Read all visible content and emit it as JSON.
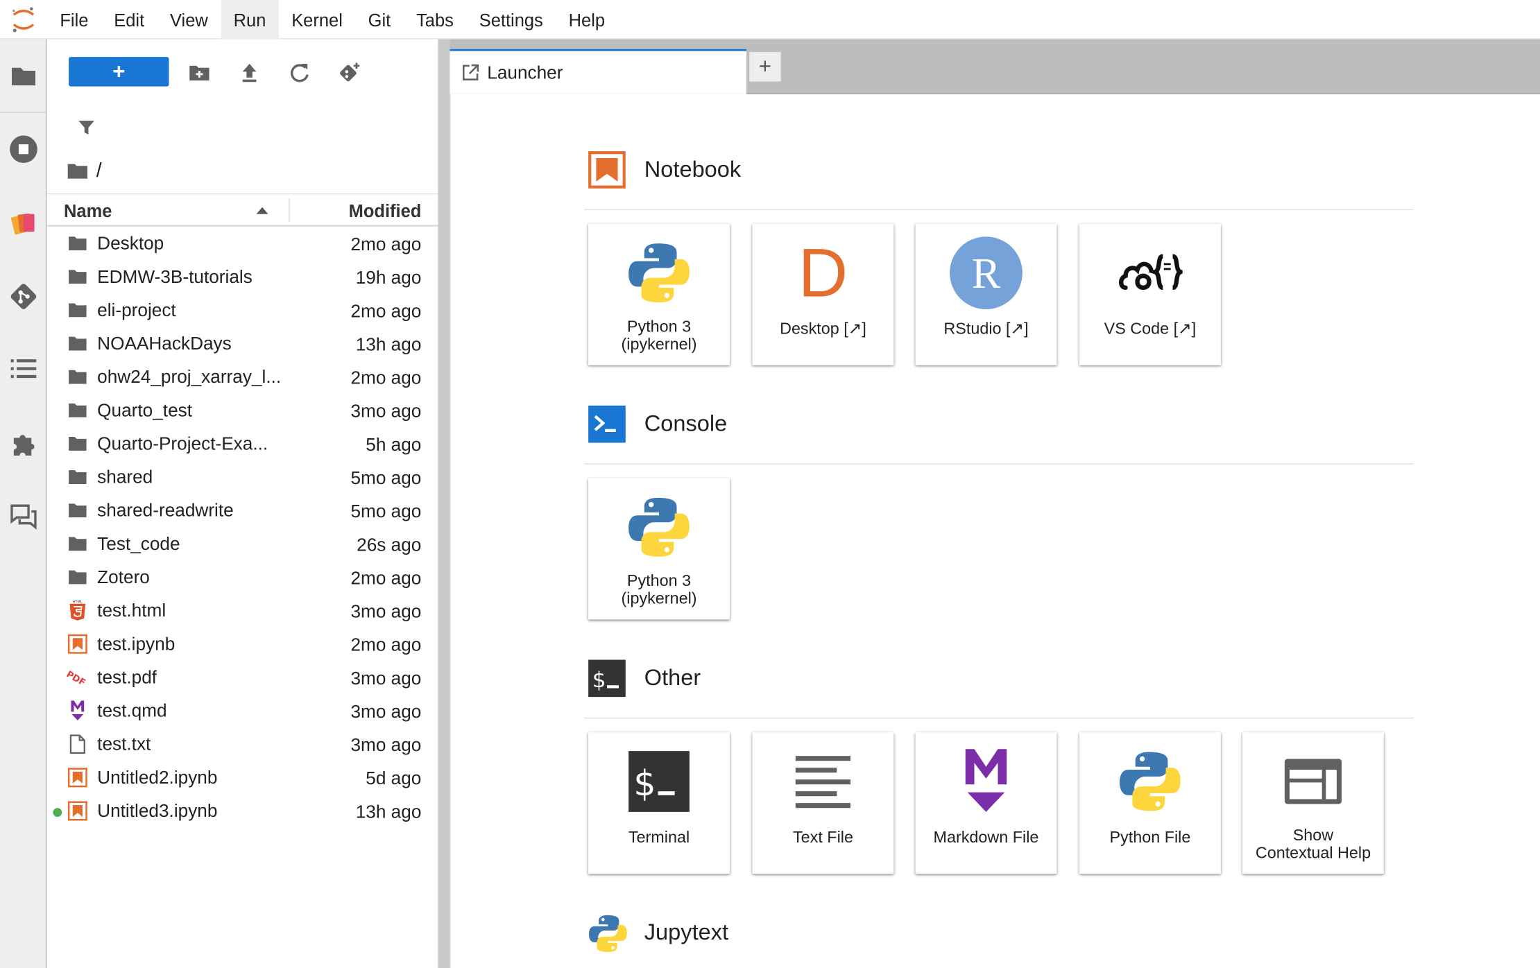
{
  "menu": [
    "File",
    "Edit",
    "View",
    "Run",
    "Kernel",
    "Git",
    "Tabs",
    "Settings",
    "Help"
  ],
  "menu_active": "Run",
  "filebrowser": {
    "new_label": "+",
    "breadcrumb": "/",
    "header_name": "Name",
    "header_modified": "Modified",
    "items": [
      {
        "name": "Desktop",
        "modified": "2mo ago",
        "type": "folder"
      },
      {
        "name": "EDMW-3B-tutorials",
        "modified": "19h ago",
        "type": "folder"
      },
      {
        "name": "eli-project",
        "modified": "2mo ago",
        "type": "folder"
      },
      {
        "name": "NOAAHackDays",
        "modified": "13h ago",
        "type": "folder"
      },
      {
        "name": "ohw24_proj_xarray_l...",
        "modified": "2mo ago",
        "type": "folder"
      },
      {
        "name": "Quarto_test",
        "modified": "3mo ago",
        "type": "folder"
      },
      {
        "name": "Quarto-Project-Exa...",
        "modified": "5h ago",
        "type": "folder"
      },
      {
        "name": "shared",
        "modified": "5mo ago",
        "type": "folder"
      },
      {
        "name": "shared-readwrite",
        "modified": "5mo ago",
        "type": "folder"
      },
      {
        "name": "Test_code",
        "modified": "26s ago",
        "type": "folder"
      },
      {
        "name": "Zotero",
        "modified": "2mo ago",
        "type": "folder"
      },
      {
        "name": "test.html",
        "modified": "3mo ago",
        "type": "html"
      },
      {
        "name": "test.ipynb",
        "modified": "2mo ago",
        "type": "notebook"
      },
      {
        "name": "test.pdf",
        "modified": "3mo ago",
        "type": "pdf"
      },
      {
        "name": "test.qmd",
        "modified": "3mo ago",
        "type": "markdown"
      },
      {
        "name": "test.txt",
        "modified": "3mo ago",
        "type": "text"
      },
      {
        "name": "Untitled2.ipynb",
        "modified": "5d ago",
        "type": "notebook"
      },
      {
        "name": "Untitled3.ipynb",
        "modified": "13h ago",
        "type": "notebook",
        "running": true
      }
    ]
  },
  "tabs": {
    "active_label": "Launcher",
    "add_label": "+"
  },
  "launcher": {
    "sections": {
      "notebook": {
        "title": "Notebook",
        "cards": [
          {
            "label": "Python 3 (ipykernel)",
            "icon": "python-icon"
          },
          {
            "label": "Desktop [↗]",
            "icon": "desktop-d-icon"
          },
          {
            "label": "RStudio [↗]",
            "icon": "rstudio-icon"
          },
          {
            "label": "VS Code [↗]",
            "icon": "vscode-icon"
          }
        ]
      },
      "console": {
        "title": "Console",
        "cards": [
          {
            "label": "Python 3 (ipykernel)",
            "icon": "python-icon"
          }
        ]
      },
      "other": {
        "title": "Other",
        "cards": [
          {
            "label": "Terminal",
            "icon": "terminal-icon"
          },
          {
            "label": "Text File",
            "icon": "text-file-icon"
          },
          {
            "label": "Markdown File",
            "icon": "markdown-icon"
          },
          {
            "label": "Python File",
            "icon": "python-icon"
          },
          {
            "label": "Show Contextual Help",
            "icon": "contextual-help-icon"
          }
        ]
      },
      "jupytext": {
        "title": "Jupytext"
      }
    }
  },
  "colors": {
    "accent": "#1976d2",
    "notebook_orange": "#e46e2e",
    "markdown_purple": "#7b2ea8",
    "running_dot": "#4caf50"
  }
}
